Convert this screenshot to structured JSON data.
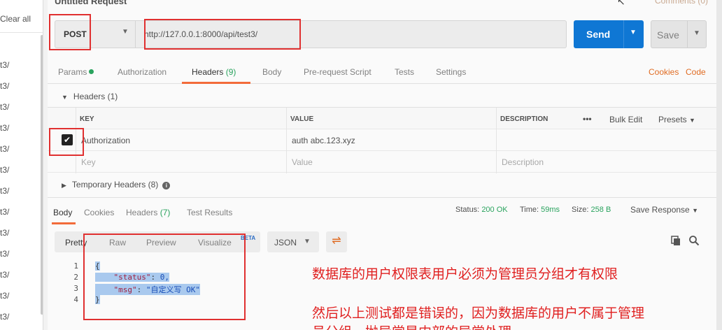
{
  "sidebar": {
    "clear_all": "Clear all",
    "history": [
      "t3/",
      "t3/",
      "t3/",
      "t3/",
      "t3/",
      "t3/",
      "t3/",
      "t3/",
      "t3/",
      "t3/",
      "t3/",
      "t3/",
      "t3/"
    ]
  },
  "request": {
    "title": "Untitled Request",
    "comments": "Comments (0)",
    "method": "POST",
    "url": "http://127.0.0.1:8000/api/test3/",
    "send_label": "Send",
    "save_label": "Save"
  },
  "tabs": {
    "params": "Params",
    "authorization": "Authorization",
    "headers": "Headers",
    "headers_count": "(9)",
    "body": "Body",
    "prerequest": "Pre-request Script",
    "tests": "Tests",
    "settings": "Settings",
    "cookies": "Cookies",
    "code": "Code"
  },
  "headers_section": {
    "title": "Headers",
    "count": "(1)",
    "col_key": "KEY",
    "col_value": "VALUE",
    "col_description": "DESCRIPTION",
    "more": "•••",
    "bulk_edit": "Bulk Edit",
    "presets": "Presets",
    "rows": [
      {
        "key": "Authorization",
        "value": "auth abc.123.xyz",
        "description": "",
        "checked": true
      }
    ],
    "placeholder_key": "Key",
    "placeholder_value": "Value",
    "placeholder_description": "Description",
    "temporary_title": "Temporary Headers",
    "temporary_count": "(8)"
  },
  "response": {
    "tabs": {
      "body": "Body",
      "cookies": "Cookies",
      "headers": "Headers",
      "headers_count": "(7)",
      "test_results": "Test Results"
    },
    "status_label": "Status:",
    "status_value": "200 OK",
    "time_label": "Time:",
    "time_value": "59ms",
    "size_label": "Size:",
    "size_value": "258 B",
    "save_response": "Save Response",
    "views": [
      "Pretty",
      "Raw",
      "Preview",
      "Visualize"
    ],
    "beta": "BETA",
    "format": "JSON",
    "code_lines": [
      {
        "n": "1",
        "text": "{"
      },
      {
        "n": "2",
        "key": "\"status\"",
        "val": "0,"
      },
      {
        "n": "3",
        "key": "\"msg\"",
        "val": "\"自定义写 OK\""
      },
      {
        "n": "4",
        "text": "}"
      }
    ]
  },
  "annotation": {
    "line1": "数据库的用户权限表用户必须为管理员分组才有权限",
    "line2": "然后以上测试都是错误的，因为数据库的用户不属于管理",
    "line3": "员分组，抛异常是内部的异常处理"
  },
  "colors": {
    "accent": "#f26b3a",
    "send": "#0f77d4",
    "status_ok": "#2aa35e",
    "link": "#e06c23",
    "annotation": "#e02020"
  }
}
